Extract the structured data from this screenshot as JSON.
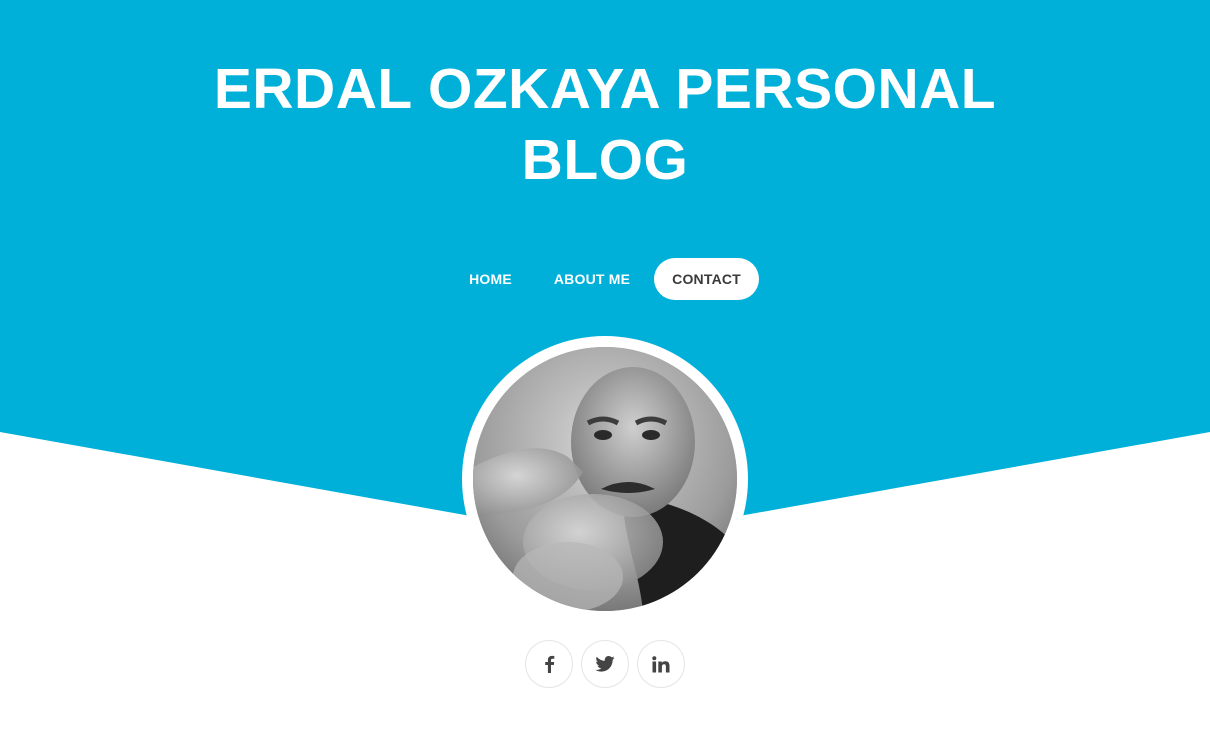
{
  "site": {
    "title": "ERDAL OZKAYA PERSONAL BLOG"
  },
  "nav": {
    "items": [
      {
        "label": "HOME",
        "active": false
      },
      {
        "label": "ABOUT ME",
        "active": false
      },
      {
        "label": "CONTACT",
        "active": true
      }
    ]
  },
  "social": [
    {
      "name": "facebook",
      "icon": "facebook-icon"
    },
    {
      "name": "twitter",
      "icon": "twitter-icon"
    },
    {
      "name": "linkedin",
      "icon": "linkedin-icon"
    }
  ],
  "colors": {
    "brand": "#00b0d9",
    "nav_active_bg": "#ffffff",
    "nav_active_text": "#3a3a3a",
    "social_icon": "#444444"
  }
}
